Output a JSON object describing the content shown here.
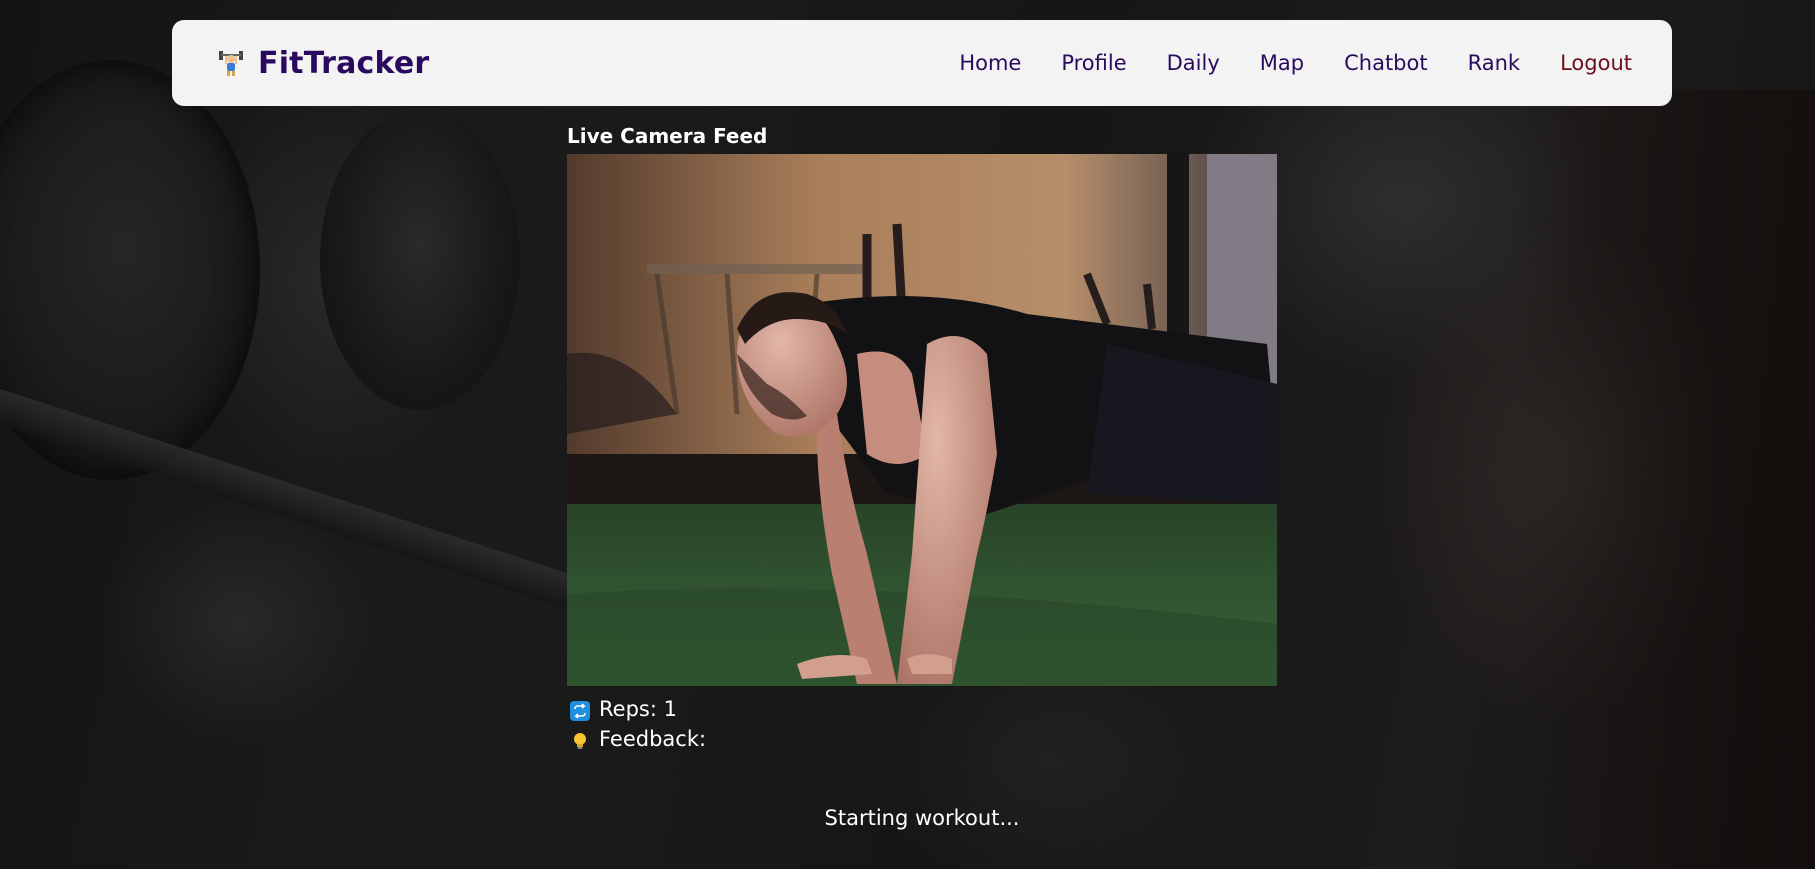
{
  "app": {
    "brand_name": "FitTracker",
    "brand_icon": "weightlifter-icon"
  },
  "nav": {
    "items": [
      {
        "label": "Home"
      },
      {
        "label": "Profile"
      },
      {
        "label": "Daily"
      },
      {
        "label": "Map"
      },
      {
        "label": "Chatbot"
      },
      {
        "label": "Rank"
      },
      {
        "label": "Logout"
      }
    ]
  },
  "feed": {
    "title": "Live Camera Feed"
  },
  "stats": {
    "reps_label": "Reps: 1",
    "reps_icon": "repeat-icon",
    "feedback_label": "Feedback:",
    "feedback_icon": "lightbulb-icon"
  },
  "status": {
    "message": "Starting workout..."
  },
  "colors": {
    "brand": "#2a0a5e",
    "logout": "#6b0f1a",
    "navbar_bg": "#f3f3f3"
  }
}
